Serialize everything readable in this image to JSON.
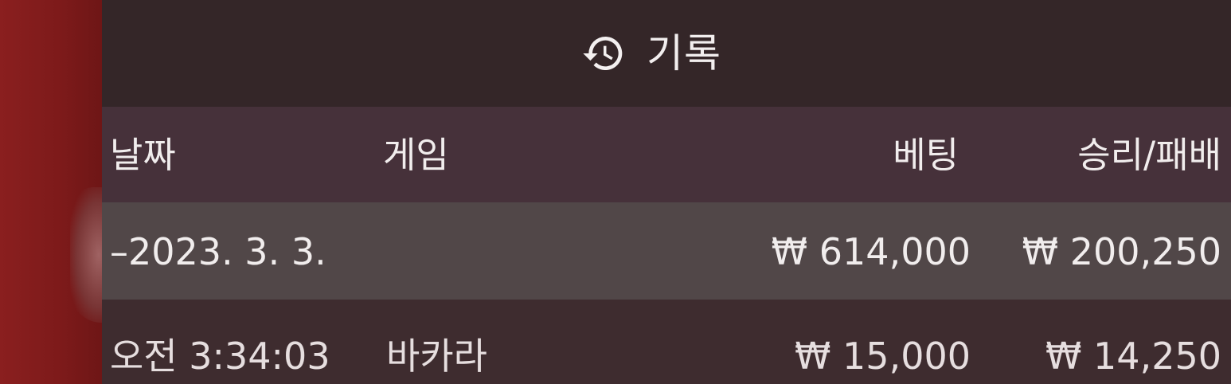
{
  "header": {
    "icon": "history-icon",
    "title": "기록"
  },
  "columns": {
    "date": "날짜",
    "game": "게임",
    "bet": "베팅",
    "win_loss": "승리/패배"
  },
  "groups": [
    {
      "date": "–2023. 3. 3.",
      "bet_total": "₩ 614,000",
      "win_loss_total": "₩ 200,250",
      "rows": [
        {
          "time": "오전 3:34:03",
          "game": "바카라",
          "bet": "₩ 15,000",
          "win_loss": "₩ 14,250"
        }
      ]
    }
  ],
  "colors": {
    "panel": "#3d2b2e",
    "header": "#342628",
    "column_header": "#46313a",
    "group_row": "#514748",
    "background_left": "#7a1c1c"
  }
}
